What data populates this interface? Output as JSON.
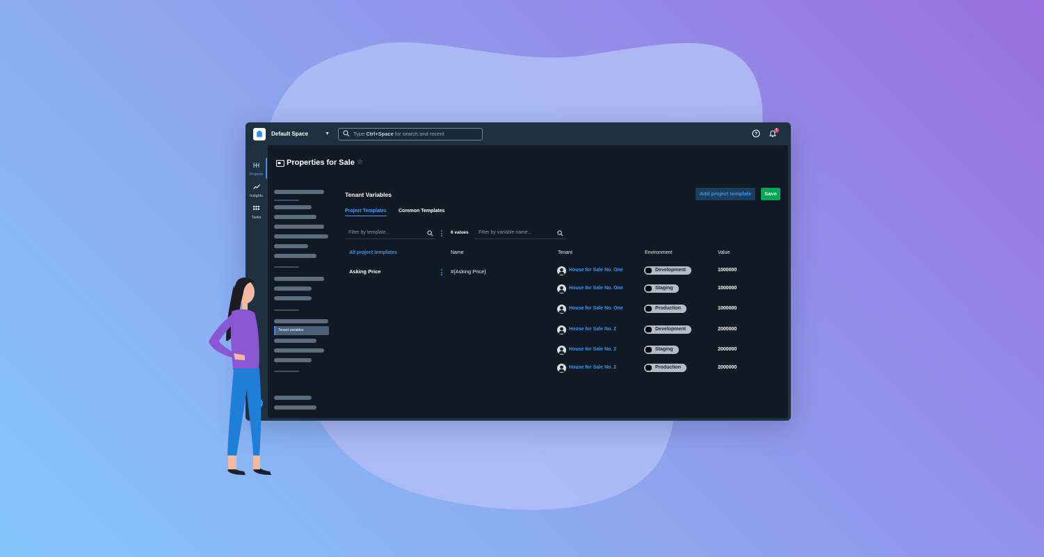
{
  "colors": {
    "background_start": "#84c6fb",
    "background_end": "#9a70df",
    "window_chrome": "#1f303f",
    "content_bg": "#111a24",
    "accent_blue": "#3d95ea",
    "save_green": "#00a651"
  },
  "topbar": {
    "space_name": "Default Space",
    "search_prefix": "Type",
    "search_shortcut": "Ctrl+Space",
    "search_suffix": "for search and recent",
    "notification_count": "1",
    "icons": [
      "help-icon",
      "bell-icon"
    ]
  },
  "leftnav": {
    "items": [
      {
        "label": "Projects",
        "icon": "projects-icon",
        "active": true
      },
      {
        "label": "Insights",
        "icon": "chart-icon",
        "active": false
      },
      {
        "label": "Tasks",
        "icon": "grid-icon",
        "active": false
      }
    ]
  },
  "page": {
    "title": "Properties for Sale",
    "sidebar_active_item": "Tenant variables"
  },
  "section": {
    "title": "Tenant Variables",
    "add_button": "Add project template",
    "save_button": "Save",
    "tabs": [
      {
        "label": "Project Templates",
        "active": true
      },
      {
        "label": "Common Templates",
        "active": false
      }
    ]
  },
  "filters": {
    "template_placeholder": "Filter by template...",
    "values_count": "6 values",
    "variable_placeholder": "Filter by variable name..."
  },
  "table": {
    "headers": {
      "name": "Name",
      "tenant": "Tenant",
      "environment": "Environment",
      "value": "Value"
    },
    "all_templates_label": "All project templates",
    "template": {
      "name": "Asking Price",
      "expression": "#{Asking Price}"
    },
    "rows": [
      {
        "tenant": "House for Sale No. One",
        "environment": "Development",
        "value": "1000000"
      },
      {
        "tenant": "House for Sale No. One",
        "environment": "Staging",
        "value": "1000000"
      },
      {
        "tenant": "House for Sale No. One",
        "environment": "Production",
        "value": "1000000"
      },
      {
        "tenant": "House for Sale No. 2",
        "environment": "Development",
        "value": "2000000"
      },
      {
        "tenant": "House for Sale No. 2",
        "environment": "Staging",
        "value": "2000000"
      },
      {
        "tenant": "House for Sale No. 2",
        "environment": "Production",
        "value": "2000000"
      }
    ]
  }
}
